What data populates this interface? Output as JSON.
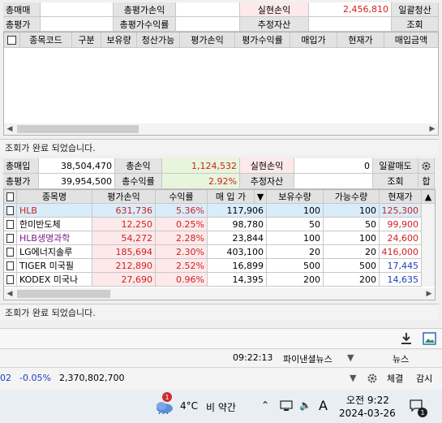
{
  "top_summary": {
    "buy_total_label": "총매매",
    "eval_total_label": "총평가",
    "eval_pl_label": "총평가손익",
    "eval_rate_label": "총평가수익률",
    "realized_pl_label": "실현손익",
    "realized_pl_value": "2,456,810",
    "est_assets_label": "추정자산",
    "bulk_settle_button": "일괄청산",
    "query_button": "조회"
  },
  "top_table": {
    "columns": [
      "종목코드",
      "구분",
      "보유량",
      "청산가능",
      "평가손익",
      "평가수익률",
      "매입가",
      "현재가",
      "매입금액"
    ]
  },
  "status_top": "조회가 완료 되었습니다.",
  "mid_summary": {
    "buy_total_label": "총매입",
    "buy_total_value": "38,504,470",
    "pl_label": "총손익",
    "pl_value": "1,124,532",
    "realized_label": "실현손익",
    "realized_value": "0",
    "bulk_sell_button": "일괄매도",
    "eval_label": "총평가",
    "eval_value": "39,954,500",
    "rate_label": "총수익률",
    "rate_value": "2.92%",
    "est_assets_label": "추정자산",
    "query_button": "조회",
    "sum_button": "합"
  },
  "holdings": {
    "columns": [
      "종목명",
      "평가손익",
      "수익률",
      "매 입 가",
      "보유수량",
      "가능수량",
      "현재가"
    ],
    "rows": [
      {
        "name": "HLB",
        "pl": "631,736",
        "rate": "5.36%",
        "buy": "117,906",
        "qty": "100",
        "avail": "100",
        "cur": "125,300",
        "name_color": "red",
        "cur_color": "red"
      },
      {
        "name": "한미반도체",
        "pl": "12,250",
        "rate": "0.25%",
        "buy": "98,780",
        "qty": "50",
        "avail": "50",
        "cur": "99,900",
        "name_color": "black",
        "cur_color": "red"
      },
      {
        "name": "HLB생명과학",
        "pl": "54,272",
        "rate": "2.28%",
        "buy": "23,844",
        "qty": "100",
        "avail": "100",
        "cur": "24,600",
        "name_color": "purple",
        "cur_color": "red"
      },
      {
        "name": "LG에너지솔루",
        "pl": "185,694",
        "rate": "2.30%",
        "buy": "403,100",
        "qty": "20",
        "avail": "20",
        "cur": "416,000",
        "name_color": "black",
        "cur_color": "red"
      },
      {
        "name": "TIGER 미국필",
        "pl": "212,890",
        "rate": "2.52%",
        "buy": "16,899",
        "qty": "500",
        "avail": "500",
        "cur": "17,445",
        "name_color": "black",
        "cur_color": "blue"
      },
      {
        "name": "KODEX 미국나",
        "pl": "27,690",
        "rate": "0.96%",
        "buy": "14,395",
        "qty": "200",
        "avail": "200",
        "cur": "14,635",
        "name_color": "black",
        "cur_color": "blue"
      }
    ]
  },
  "status_mid": "조회가 완료 되었습니다.",
  "ticker_bar": {
    "time": "09:22:13",
    "news_source": "파이낸셜뉴스",
    "news_button": "뉴스",
    "left_fragment": "02",
    "change": "-0.05%",
    "volume": "2,370,802,700",
    "tab_fill": "체결",
    "tab_watch": "감시"
  },
  "taskbar": {
    "weather_temp": "4°C",
    "weather_desc": "비 약간",
    "ime": "A",
    "time": "오전 9:22",
    "date": "2024-03-26",
    "weather_badge": "1",
    "notify_badge": "1"
  },
  "colors": {
    "profit_red": "#d01f1f",
    "price_blue": "#1a3fc0",
    "ticker_blue": "#1a3fc0",
    "selected_row": "#d9ecf9"
  }
}
